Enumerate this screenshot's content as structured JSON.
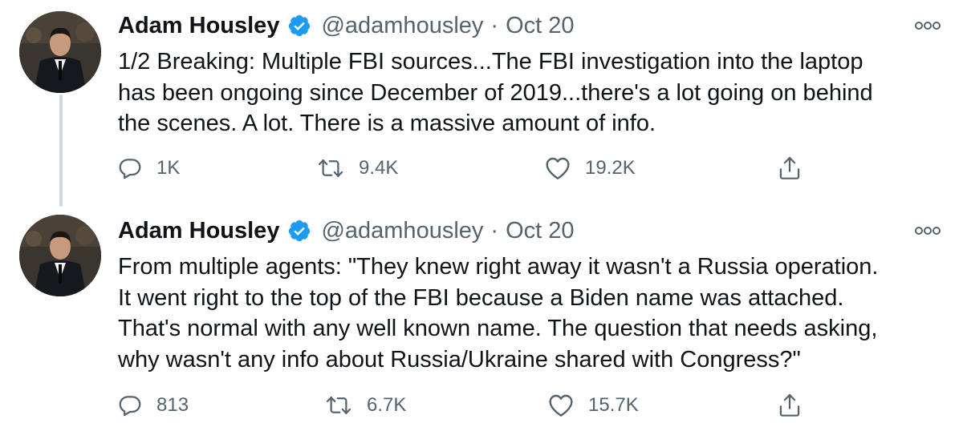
{
  "tweets": [
    {
      "author": {
        "name": "Adam Housley",
        "handle": "@adamhousley",
        "verified_icon": "verified-badge-icon"
      },
      "separator": "·",
      "date": "Oct 20",
      "text_lines": [
        "1/2  Breaking: Multiple FBI sources...The FBI investigation into the laptop",
        "has been ongoing since December of 2019...there's a lot going on behind",
        "the scenes. A lot. There is a massive amount of info."
      ],
      "actions": {
        "replies": "1K",
        "retweets": "9.4K",
        "likes": "19.2K"
      }
    },
    {
      "author": {
        "name": "Adam Housley",
        "handle": "@adamhousley",
        "verified_icon": "verified-badge-icon"
      },
      "separator": "·",
      "date": "Oct 20",
      "text_lines": [
        "From multiple agents: \"They knew right away it wasn't a Russia operation.",
        "It went right to the top of the FBI because a Biden name was attached.",
        "That's normal with any well known name. The question that needs asking,",
        "why wasn't any info about Russia/Ukraine shared with Congress?\""
      ],
      "actions": {
        "replies": "813",
        "retweets": "6.7K",
        "likes": "15.7K"
      }
    }
  ],
  "colors": {
    "text": "#0f1419",
    "secondary": "#536471",
    "verified": "#1d9bf0",
    "thread_line": "#cfd9de"
  }
}
